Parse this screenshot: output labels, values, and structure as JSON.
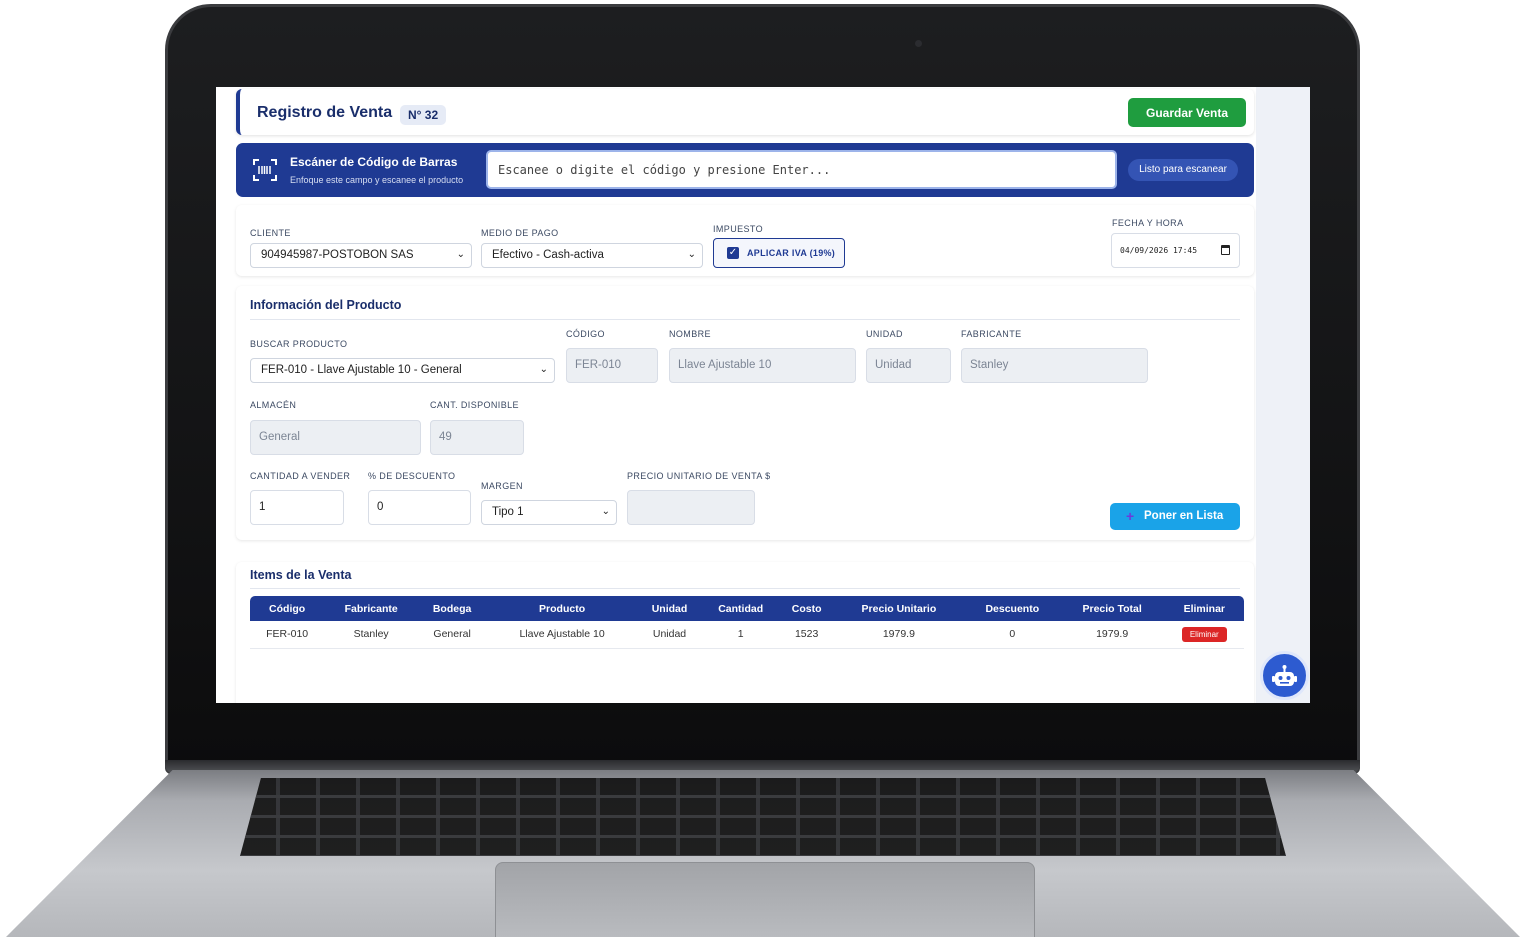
{
  "header": {
    "title": "Registro de Venta",
    "doc_number": "N° 32",
    "save_label": "Guardar Venta"
  },
  "scanner": {
    "title": "Escáner de Código de Barras",
    "subtitle": "Enfoque este campo y escanee el producto",
    "placeholder": "Escanee o digite el código y presione Enter...",
    "status": "Listo para escanear"
  },
  "sale": {
    "client_label": "CLIENTE",
    "client_value": "904945987-POSTOBON SAS",
    "payment_label": "MEDIO DE PAGO",
    "payment_value": "Efectivo - Cash-activa",
    "tax_label": "IMPUESTO",
    "tax_checkbox_label": "APLICAR IVA (19%)",
    "tax_checked": true,
    "datetime_label": "FECHA Y HORA",
    "datetime_value": "04/09/2026  17:45"
  },
  "product": {
    "section_title": "Información del Producto",
    "search_label": "BUSCAR PRODUCTO",
    "search_value": "FER-010 - Llave Ajustable 10 - General",
    "code_label": "CÓDIGO",
    "code_value": "FER-010",
    "name_label": "NOMBRE",
    "name_value": "Llave Ajustable 10",
    "unit_label": "UNIDAD",
    "unit_value": "Unidad",
    "maker_label": "FABRICANTE",
    "maker_value": "Stanley",
    "warehouse_label": "ALMACÉN",
    "warehouse_value": "General",
    "available_label": "CANT. DISPONIBLE",
    "available_value": "49",
    "qty_label": "CANTIDAD A VENDER",
    "qty_value": "1",
    "discount_label": "% DE DESCUENTO",
    "discount_value": "0",
    "margin_label": "MARGEN",
    "margin_value": "Tipo 1",
    "price_label": "PRECIO UNITARIO DE VENTA $",
    "price_value": "",
    "add_label": "Poner en Lista"
  },
  "items": {
    "section_title": "Items de la Venta",
    "columns": [
      "Código",
      "Fabricante",
      "Bodega",
      "Producto",
      "Unidad",
      "Cantidad",
      "Costo",
      "Precio Unitario",
      "Descuento",
      "Precio Total",
      "Eliminar"
    ],
    "rows": [
      {
        "codigo": "FER-010",
        "fabricante": "Stanley",
        "bodega": "General",
        "producto": "Llave Ajustable 10",
        "unidad": "Unidad",
        "cantidad": "1",
        "costo": "1523",
        "precio_unitario": "1979.9",
        "descuento": "0",
        "precio_total": "1979.9",
        "eliminar": "Eliminar"
      }
    ]
  },
  "colors": {
    "primary": "#1f3a93",
    "success": "#1f9d3f",
    "info": "#1aa3e8",
    "danger": "#dc2626"
  },
  "icons": [
    "barcode-scan-icon",
    "checkbox-checked-icon",
    "calendar-icon",
    "chevron-down-icon",
    "plus-icon",
    "robot-icon"
  ]
}
